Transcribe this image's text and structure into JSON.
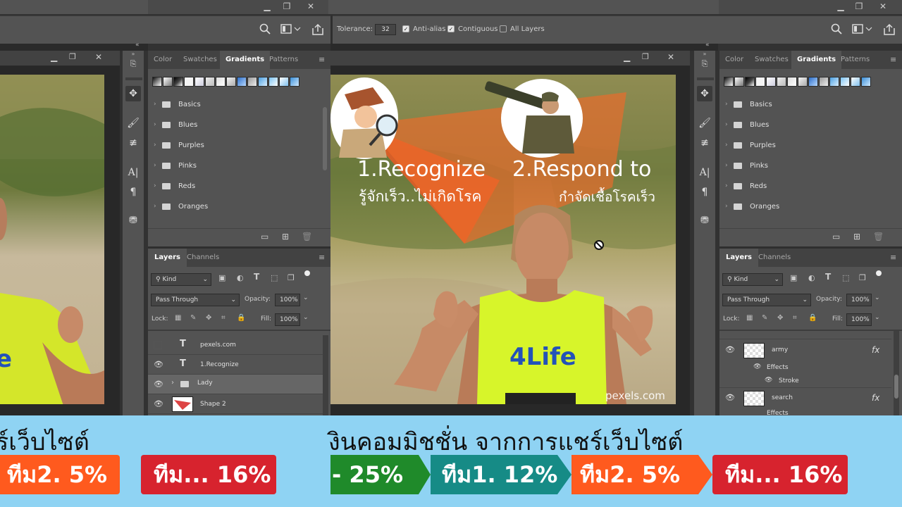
{
  "options_bar": {
    "tolerance_label": "Tolerance:",
    "tolerance_value": "32",
    "anti_alias_label": "Anti-alias",
    "contiguous_label": "Contiguous",
    "all_layers_label": "All Layers"
  },
  "left_panels": {
    "tabs": [
      "Color",
      "Swatches",
      "Gradients",
      "Patterns"
    ],
    "gradient_folders": [
      "Basics",
      "Blues",
      "Purples",
      "Pinks",
      "Reds",
      "Oranges"
    ],
    "layers_tabs": [
      "Layers",
      "Channels"
    ],
    "kind_label": "Kind",
    "blend_mode": "Pass Through",
    "opacity_label": "Opacity:",
    "opacity_value": "100%",
    "lock_label": "Lock:",
    "fill_label": "Fill:",
    "fill_value": "100%",
    "layers": [
      "pexels.com",
      "1.Recognize",
      "Lady",
      "Shape 2"
    ]
  },
  "right_panels": {
    "tabs": [
      "Color",
      "Swatches",
      "Gradients",
      "Patterns"
    ],
    "gradient_folders": [
      "Basics",
      "Blues",
      "Purples",
      "Pinks",
      "Reds",
      "Oranges"
    ],
    "layers_tabs": [
      "Layers",
      "Channels"
    ],
    "kind_label": "Kind",
    "blend_mode": "Pass Through",
    "opacity_label": "Opacity:",
    "opacity_value": "100%",
    "lock_label": "Lock:",
    "fill_label": "Fill:",
    "fill_value": "100%",
    "layer_army": "army",
    "effects_label": "Effects",
    "stroke_label": "Stroke",
    "layer_search": "search",
    "effects_label_2": "Effects",
    "fx": "fx"
  },
  "canvas": {
    "recognize_title": "1.Recognize",
    "recognize_thai": "รู้จักเร็ว..ไม่เกิดโรค",
    "respond_title": "2.Respond to",
    "respond_thai": "กำจัดเชื้อโรคเร็ว",
    "shirt_logo": "4Life",
    "watermark": "pexels.com"
  },
  "banner": {
    "left_text": "ร์เว็บไซต์",
    "main_text": "งินคอมมิชชั่น จากการแชร์เว็บไซต์",
    "left_pills": [
      {
        "label": "ทีม2. 5%",
        "color": "#ff5a1e"
      },
      {
        "label": "ทีม... 16%",
        "color": "#d7232e"
      }
    ],
    "pills": [
      {
        "label": "- 25%",
        "color": "#1f8a2a"
      },
      {
        "label": "ทีม1. 12%",
        "color": "#168b86"
      },
      {
        "label": "ทีม2. 5%",
        "color": "#ff5a1e"
      },
      {
        "label": "ทีม... 16%",
        "color": "#d7232e"
      }
    ]
  },
  "colors": {
    "ps_panel": "#535353",
    "ps_dark": "#323232",
    "banner_bg": "#8fd3f3",
    "shirt_neon": "#d7f52a",
    "logo_blue": "#2352b8"
  }
}
